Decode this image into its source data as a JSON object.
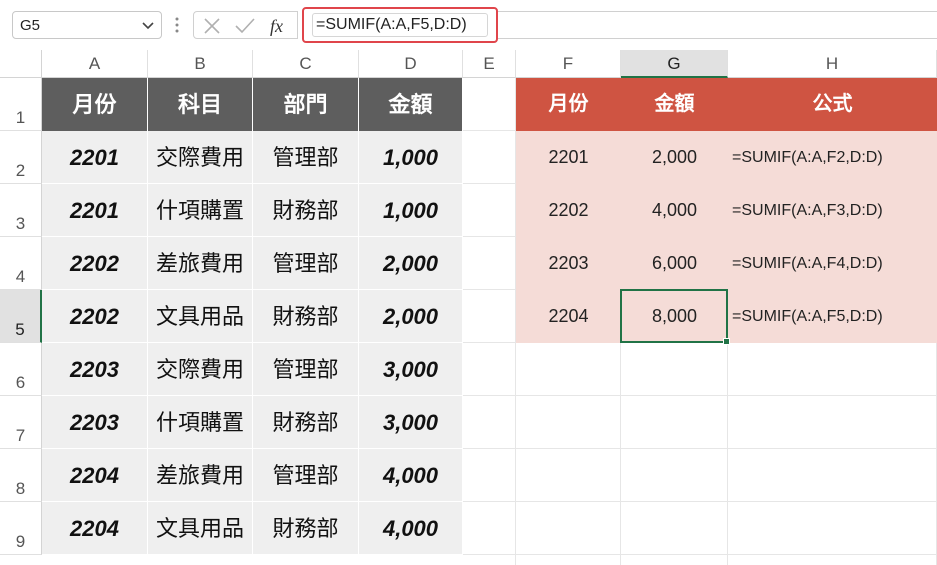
{
  "formula_bar": {
    "name_box": "G5",
    "formula": "=SUMIF(A:A,F5,D:D)",
    "icons": [
      "chevron-down-icon",
      "more-options-icon",
      "cancel-icon",
      "enter-icon",
      "fx-icon"
    ]
  },
  "columns": [
    "A",
    "B",
    "C",
    "D",
    "E",
    "F",
    "G",
    "H"
  ],
  "rows": [
    "1",
    "2",
    "3",
    "4",
    "5",
    "6",
    "7",
    "8",
    "9"
  ],
  "left_table": {
    "headers": [
      "月份",
      "科目",
      "部門",
      "金額"
    ],
    "rows": [
      [
        "2201",
        "交際費用",
        "管理部",
        "1,000"
      ],
      [
        "2201",
        "什項購置",
        "財務部",
        "1,000"
      ],
      [
        "2202",
        "差旅費用",
        "管理部",
        "2,000"
      ],
      [
        "2202",
        "文具用品",
        "財務部",
        "2,000"
      ],
      [
        "2203",
        "交際費用",
        "管理部",
        "3,000"
      ],
      [
        "2203",
        "什項購置",
        "財務部",
        "3,000"
      ],
      [
        "2204",
        "差旅費用",
        "管理部",
        "4,000"
      ],
      [
        "2204",
        "文具用品",
        "財務部",
        "4,000"
      ]
    ]
  },
  "right_table": {
    "headers": [
      "月份",
      "金額",
      "公式"
    ],
    "rows": [
      [
        "2201",
        "2,000",
        "=SUMIF(A:A,F2,D:D)"
      ],
      [
        "2202",
        "4,000",
        "=SUMIF(A:A,F3,D:D)"
      ],
      [
        "2203",
        "6,000",
        "=SUMIF(A:A,F4,D:D)"
      ],
      [
        "2204",
        "8,000",
        "=SUMIF(A:A,F5,D:D)"
      ]
    ]
  },
  "colors": {
    "left_header": "#5e5e5e",
    "left_body": "#efefef",
    "right_header": "#cf5442",
    "right_body": "#f5dcd7",
    "selection": "#217346",
    "formula_highlight": "#e0454b"
  }
}
